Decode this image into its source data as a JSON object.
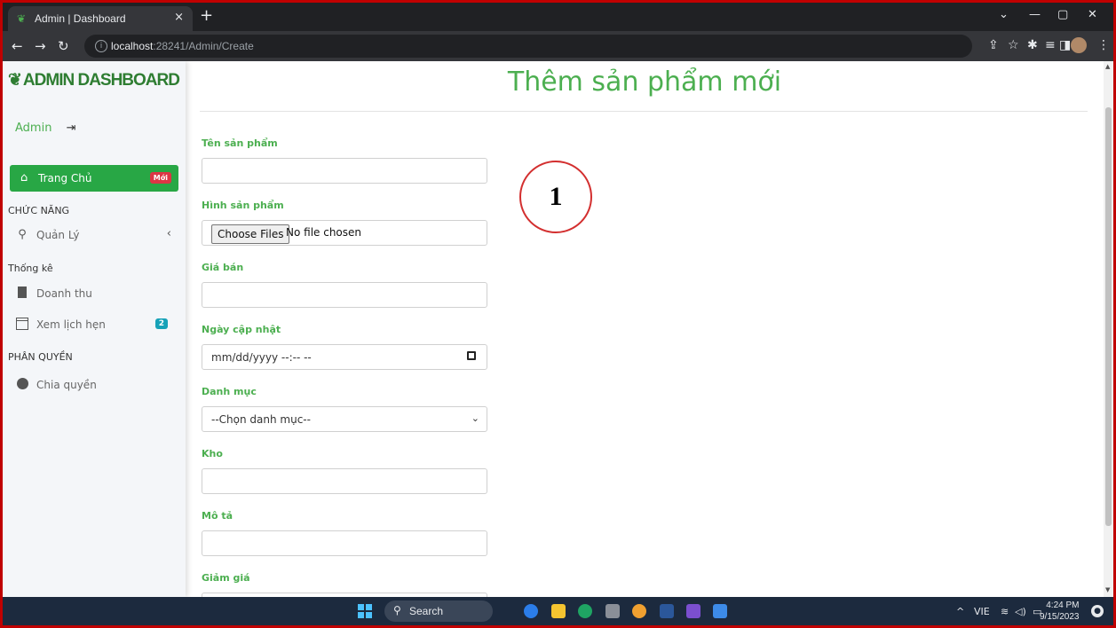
{
  "browser": {
    "tab_title": "Admin | Dashboard",
    "tab_close": "×",
    "new_tab": "+",
    "url_host": "localhost",
    "url_path": ":28241/Admin/Create",
    "win_min": "—",
    "win_max": "▢",
    "win_close": "✕",
    "chevron": "⌄"
  },
  "sidebar": {
    "brand": "ADMIN DASHBOARD",
    "user": "Admin",
    "home_label": "Trang Chủ",
    "home_badge": "Mới",
    "sections": [
      {
        "header": "CHỨC NĂNG"
      },
      {
        "header": "Thống kê"
      },
      {
        "header": "PHÂN QUYỀN"
      }
    ],
    "items": [
      {
        "label": "Quản Lý"
      },
      {
        "label": "Doanh thu"
      },
      {
        "label": "Xem lịch hẹn",
        "badge": "2"
      },
      {
        "label": "Chia quyền"
      }
    ]
  },
  "form": {
    "title": "Thêm sản phẩm mới",
    "fields": {
      "name_label": "Tên sản phẩm",
      "image_label": "Hình sản phẩm",
      "file_button": "Choose Files",
      "file_status": "No file chosen",
      "price_label": "Giá bán",
      "date_label": "Ngày cập nhật",
      "date_placeholder": "mm/dd/yyyy --:-- --",
      "category_label": "Danh mục",
      "category_selected": "--Chọn danh mục--",
      "stock_label": "Kho",
      "desc_label": "Mô tả",
      "discount_label": "Giảm giá"
    }
  },
  "annotation": {
    "number": "1",
    "color": "#d32f2f"
  },
  "taskbar": {
    "search_label": "Search",
    "lang": "VIE",
    "time": "4:24 PM",
    "date": "9/15/2023"
  },
  "colors": {
    "accent_green": "#4caf50",
    "home_green": "#28a745",
    "badge_red": "#dc3545",
    "badge_teal": "#17a2b8"
  }
}
